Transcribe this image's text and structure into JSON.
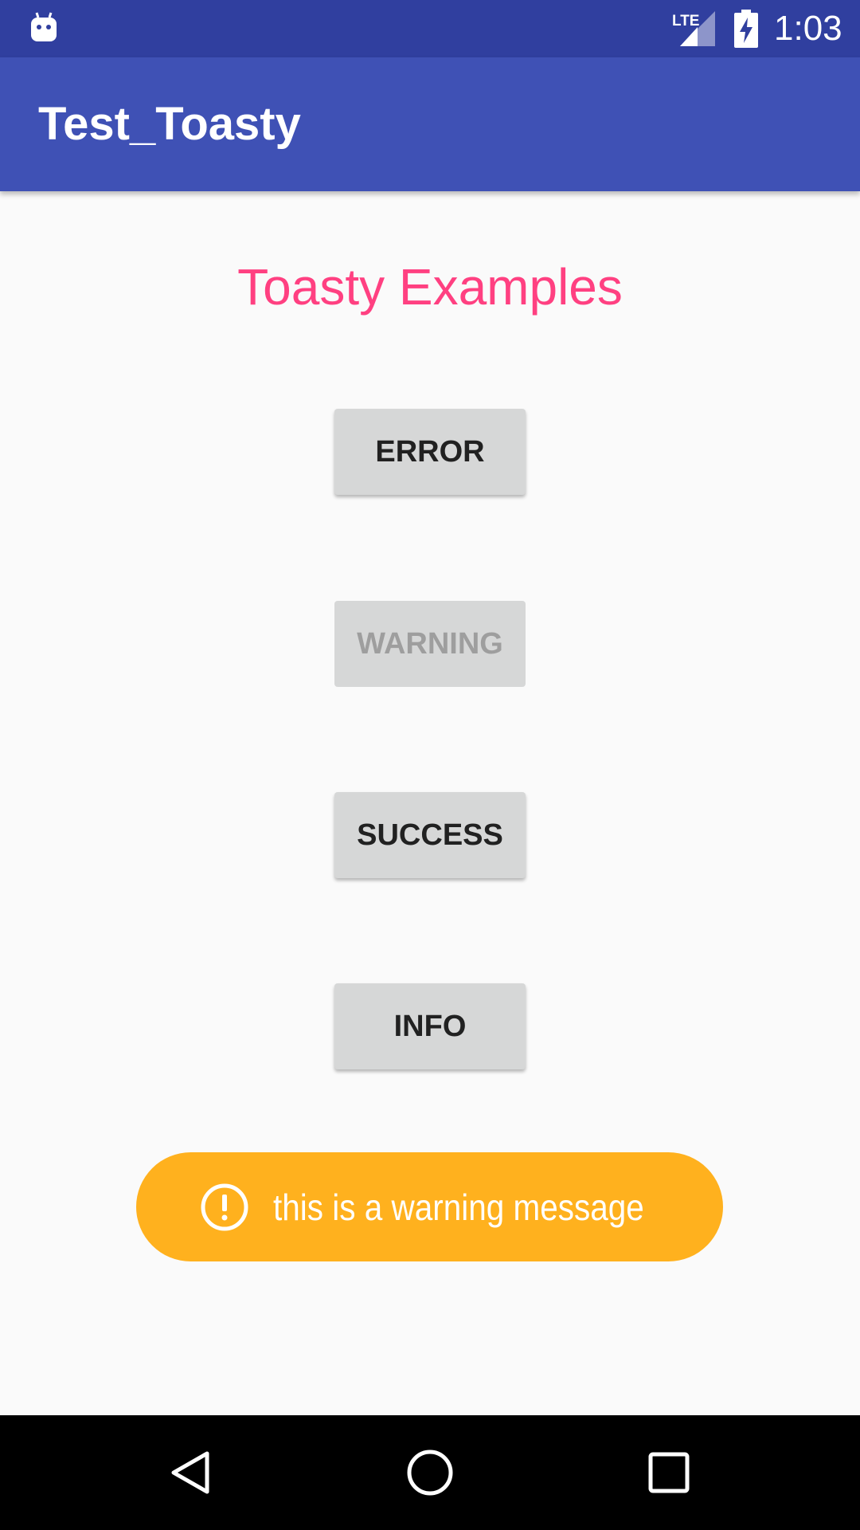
{
  "status_bar": {
    "time": "1:03",
    "network_label": "LTE",
    "icons": [
      "android-notification-icon",
      "lte-signal-icon",
      "battery-charging-icon"
    ]
  },
  "app_bar": {
    "title": "Test_Toasty",
    "color": "#3f51b5"
  },
  "main": {
    "heading": "Toasty Examples",
    "heading_color": "#ff4081",
    "buttons": [
      {
        "label": "ERROR",
        "enabled": true
      },
      {
        "label": "WARNING",
        "enabled": false
      },
      {
        "label": "SUCCESS",
        "enabled": true
      },
      {
        "label": "INFO",
        "enabled": true
      }
    ]
  },
  "toast": {
    "type": "warning",
    "message": "this is a warning message",
    "icon": "exclamation-circle-icon",
    "color": "#ffb11e"
  },
  "nav_bar": {
    "buttons": [
      "back-icon",
      "home-icon",
      "recents-icon"
    ]
  }
}
